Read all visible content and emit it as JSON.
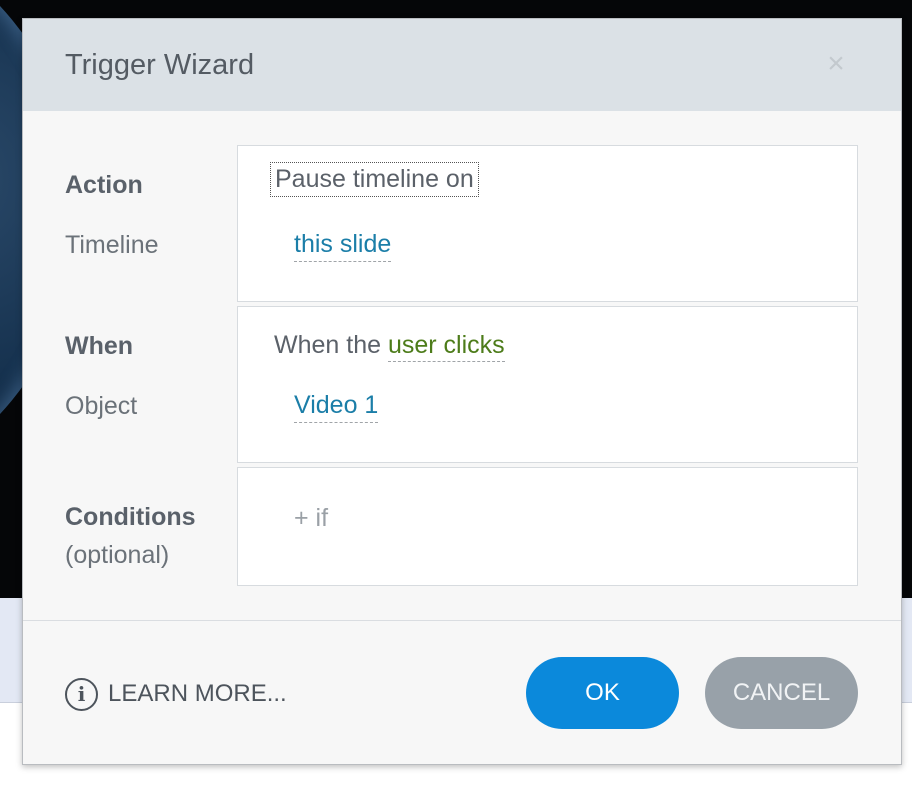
{
  "dialog": {
    "title": "Trigger Wizard",
    "close_icon": "×"
  },
  "action": {
    "label": "Action",
    "sublabel": "Timeline",
    "value": "Pause timeline on",
    "target": "this slide"
  },
  "when": {
    "label": "When",
    "sublabel": "Object",
    "prefix": "When the",
    "event": "user clicks",
    "object": "Video 1"
  },
  "conditions": {
    "label": "Conditions",
    "sublabel": "(optional)",
    "add_label": "+ if"
  },
  "footer": {
    "info_icon": "i",
    "learn_more": "LEARN MORE...",
    "ok": "OK",
    "cancel": "CANCEL"
  },
  "colors": {
    "ok_button": "#0b89db",
    "cancel_button": "#98a1a9",
    "link": "#1b7ea8",
    "event": "#4d7c1a"
  }
}
